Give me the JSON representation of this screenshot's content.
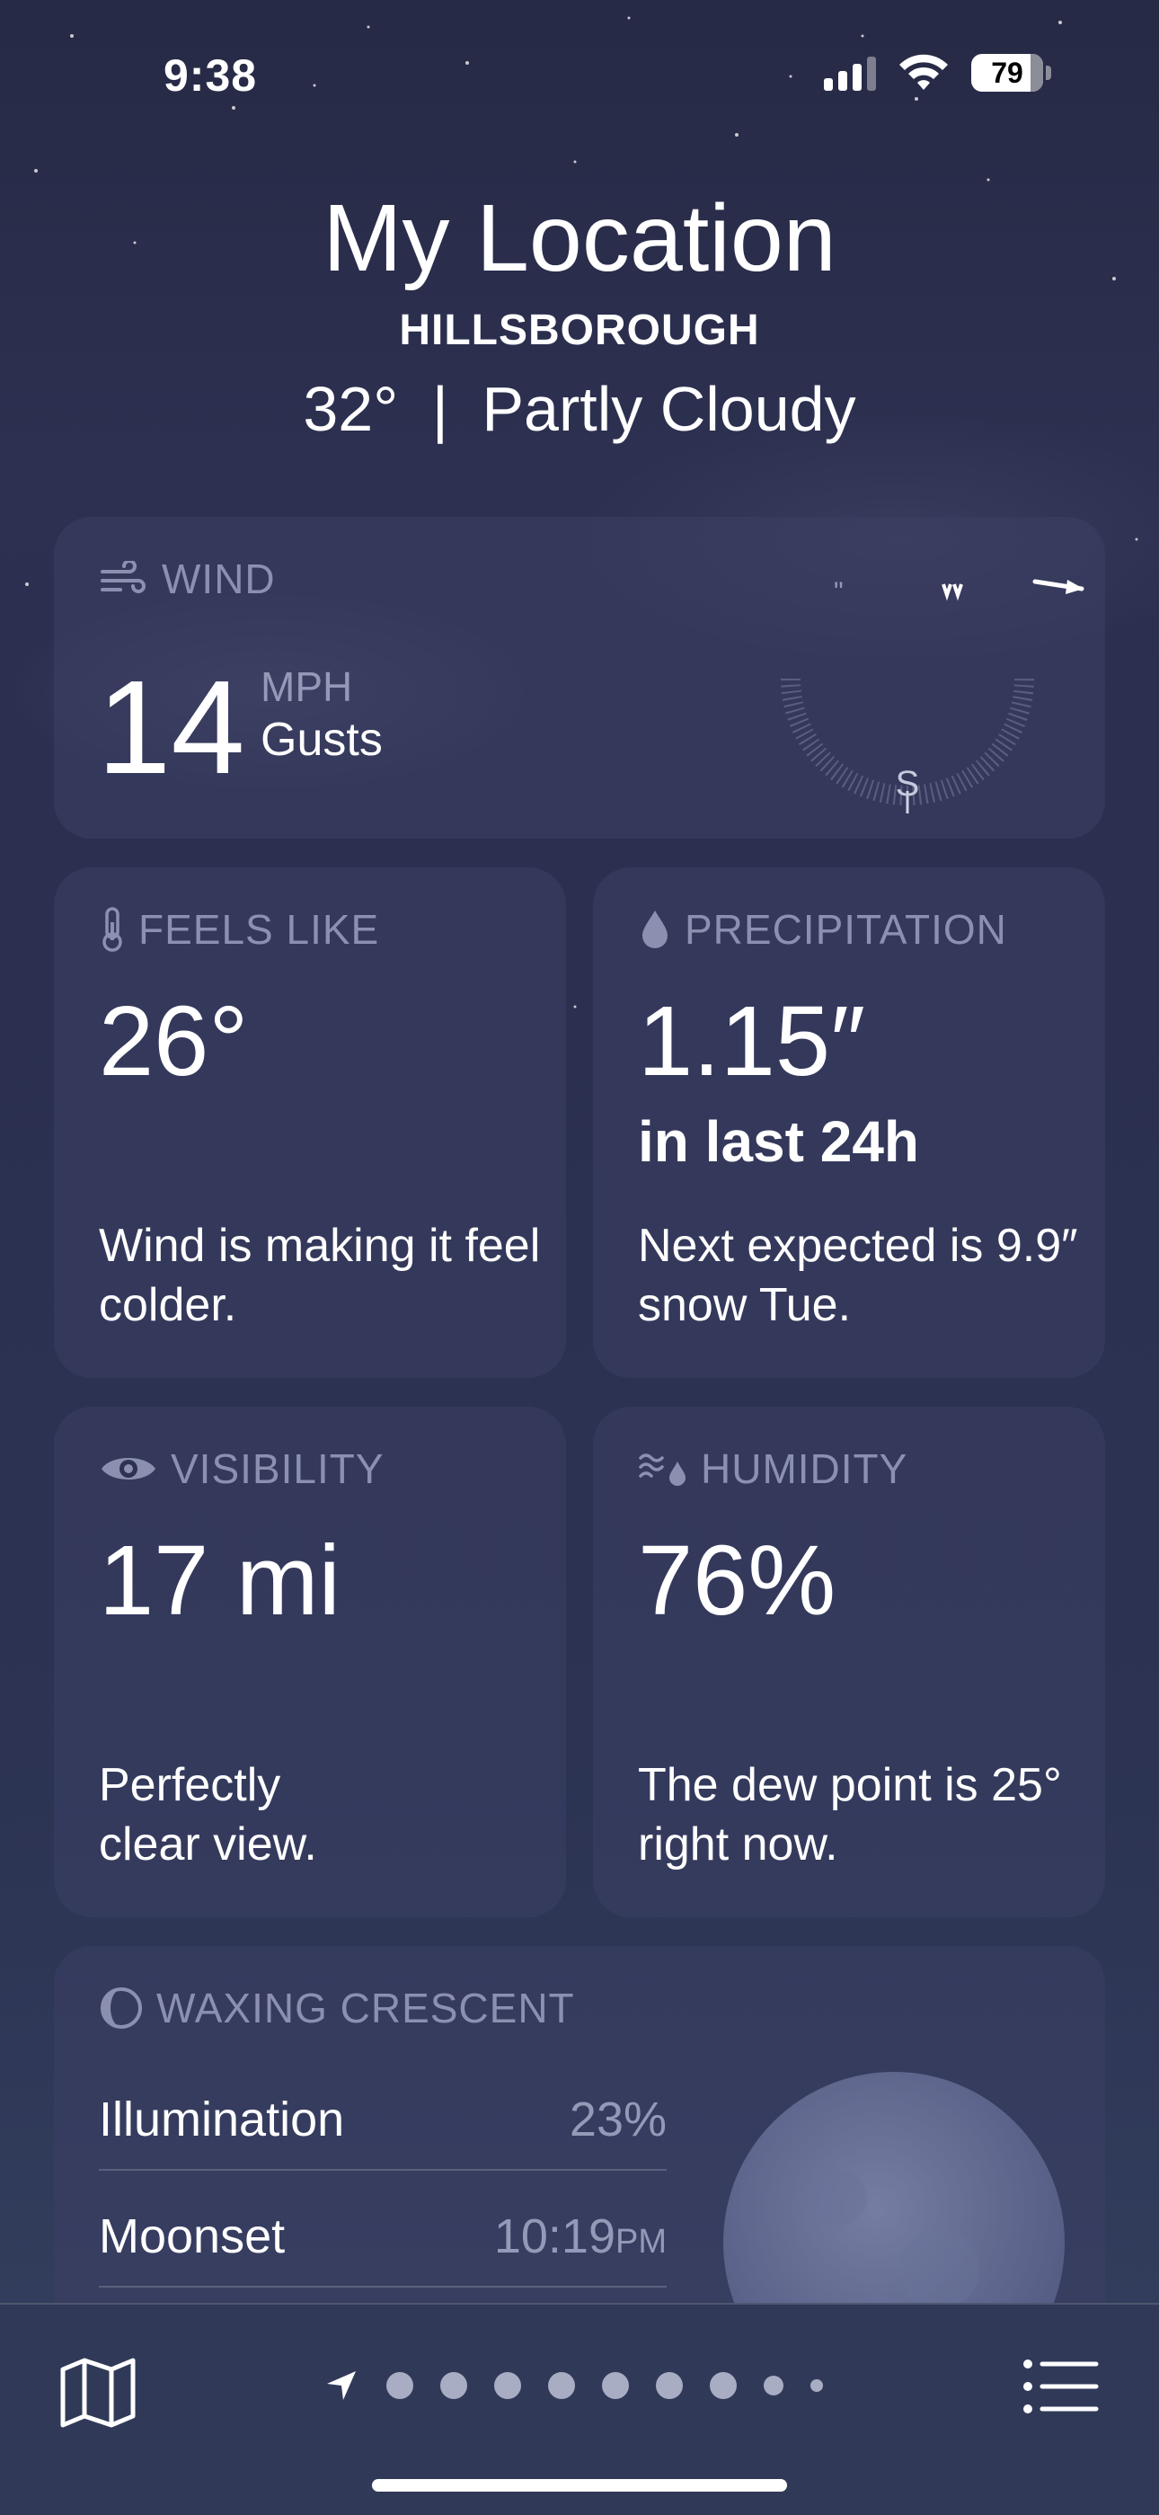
{
  "status_bar": {
    "time": "9:38",
    "battery": "79"
  },
  "header": {
    "title": "My Location",
    "subtitle": "HILLSBOROUGH",
    "temp": "32°",
    "condition": "Partly Cloudy"
  },
  "wind": {
    "label": "WIND",
    "value": "14",
    "unit": "MPH",
    "detail": "Gusts",
    "compass_south": "S"
  },
  "feels_like": {
    "label": "FEELS LIKE",
    "value": "26°",
    "description": "Wind is making it feel colder."
  },
  "precipitation": {
    "label": "PRECIPITATION",
    "value": "1.15″",
    "period": "in last 24h",
    "description": "Next expected is 9.9″ snow Tue."
  },
  "visibility": {
    "label": "VISIBILITY",
    "value": "17 mi",
    "description": "Perfectly clear view."
  },
  "humidity": {
    "label": "HUMIDITY",
    "value": "76%",
    "description": "The dew point is 25° right now."
  },
  "moon": {
    "label": "WAXING CRESCENT",
    "rows": [
      {
        "label": "Illumination",
        "value": "23%",
        "suffix": ""
      },
      {
        "label": "Moonset",
        "value": "10:19",
        "suffix": "PM"
      }
    ]
  },
  "colors": {
    "accent_muted": "#8c90b0",
    "card_bg": "#3c4064"
  }
}
